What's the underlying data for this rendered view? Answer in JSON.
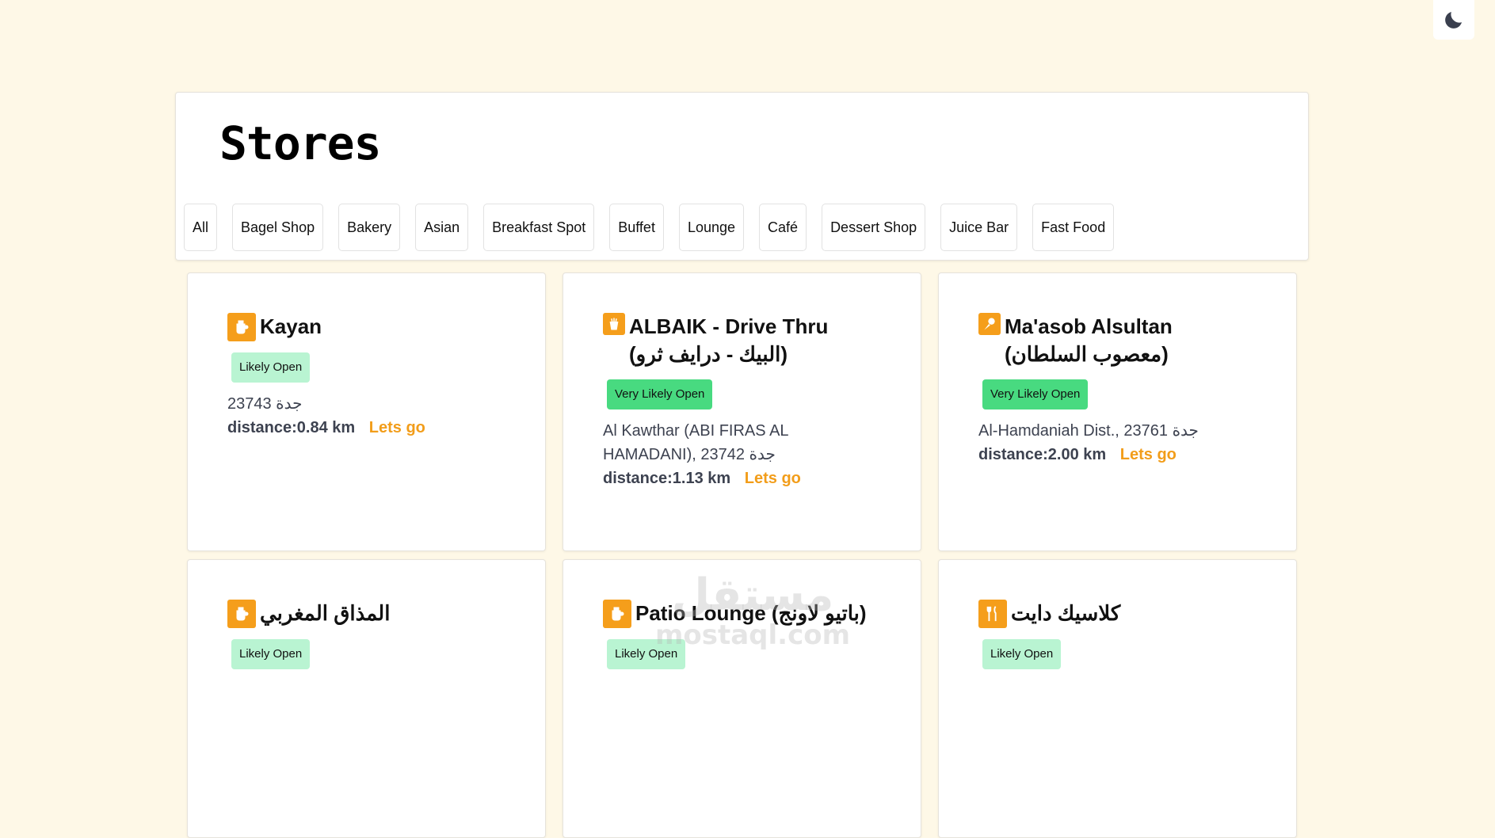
{
  "theme_toggle": {
    "icon": "moon-icon"
  },
  "header": {
    "title": "Stores"
  },
  "filters": [
    "All",
    "Bagel Shop",
    "Bakery",
    "Asian",
    "Breakfast Spot",
    "Buffet",
    "Lounge",
    "Café",
    "Dessert Shop",
    "Juice Bar",
    "Fast Food"
  ],
  "stores": [
    {
      "name": "Kayan",
      "icon": "coffee-pot-icon",
      "status": "Likely Open",
      "address": "جدة 23743",
      "distance": "distance:0.84 km",
      "action": "Lets go"
    },
    {
      "name": "ALBAIK - Drive Thru (البيك - درايف ثرو)",
      "icon": "fast-food-icon",
      "status": "Very Likely Open",
      "address": "Al Kawthar (ABI FIRAS AL HAMADANI), 23742 جدة",
      "distance": "distance:1.13 km",
      "action": "Lets go"
    },
    {
      "name": "Ma'asob Alsultan (معصوب السلطان)",
      "icon": "dessert-icon",
      "status": "Very Likely Open",
      "address": "Al-Hamdaniah Dist., 23761 جدة",
      "distance": "distance:2.00 km",
      "action": "Lets go"
    },
    {
      "name": "المذاق المغربي",
      "icon": "coffee-pot-icon",
      "status": "Likely Open"
    },
    {
      "name": "Patio Lounge (باتيو لاونج)",
      "icon": "coffee-pot-icon",
      "status": "Likely Open"
    },
    {
      "name": "كلاسيك دايت",
      "icon": "fork-knife-icon",
      "status": "Likely Open"
    }
  ],
  "watermark": {
    "arabic": "مستقل",
    "latin": "mostaql.com"
  },
  "colors": {
    "background": "#fef8e7",
    "accent": "#f59e1b",
    "likely": "#b9f4d2",
    "very_likely": "#48da80"
  }
}
